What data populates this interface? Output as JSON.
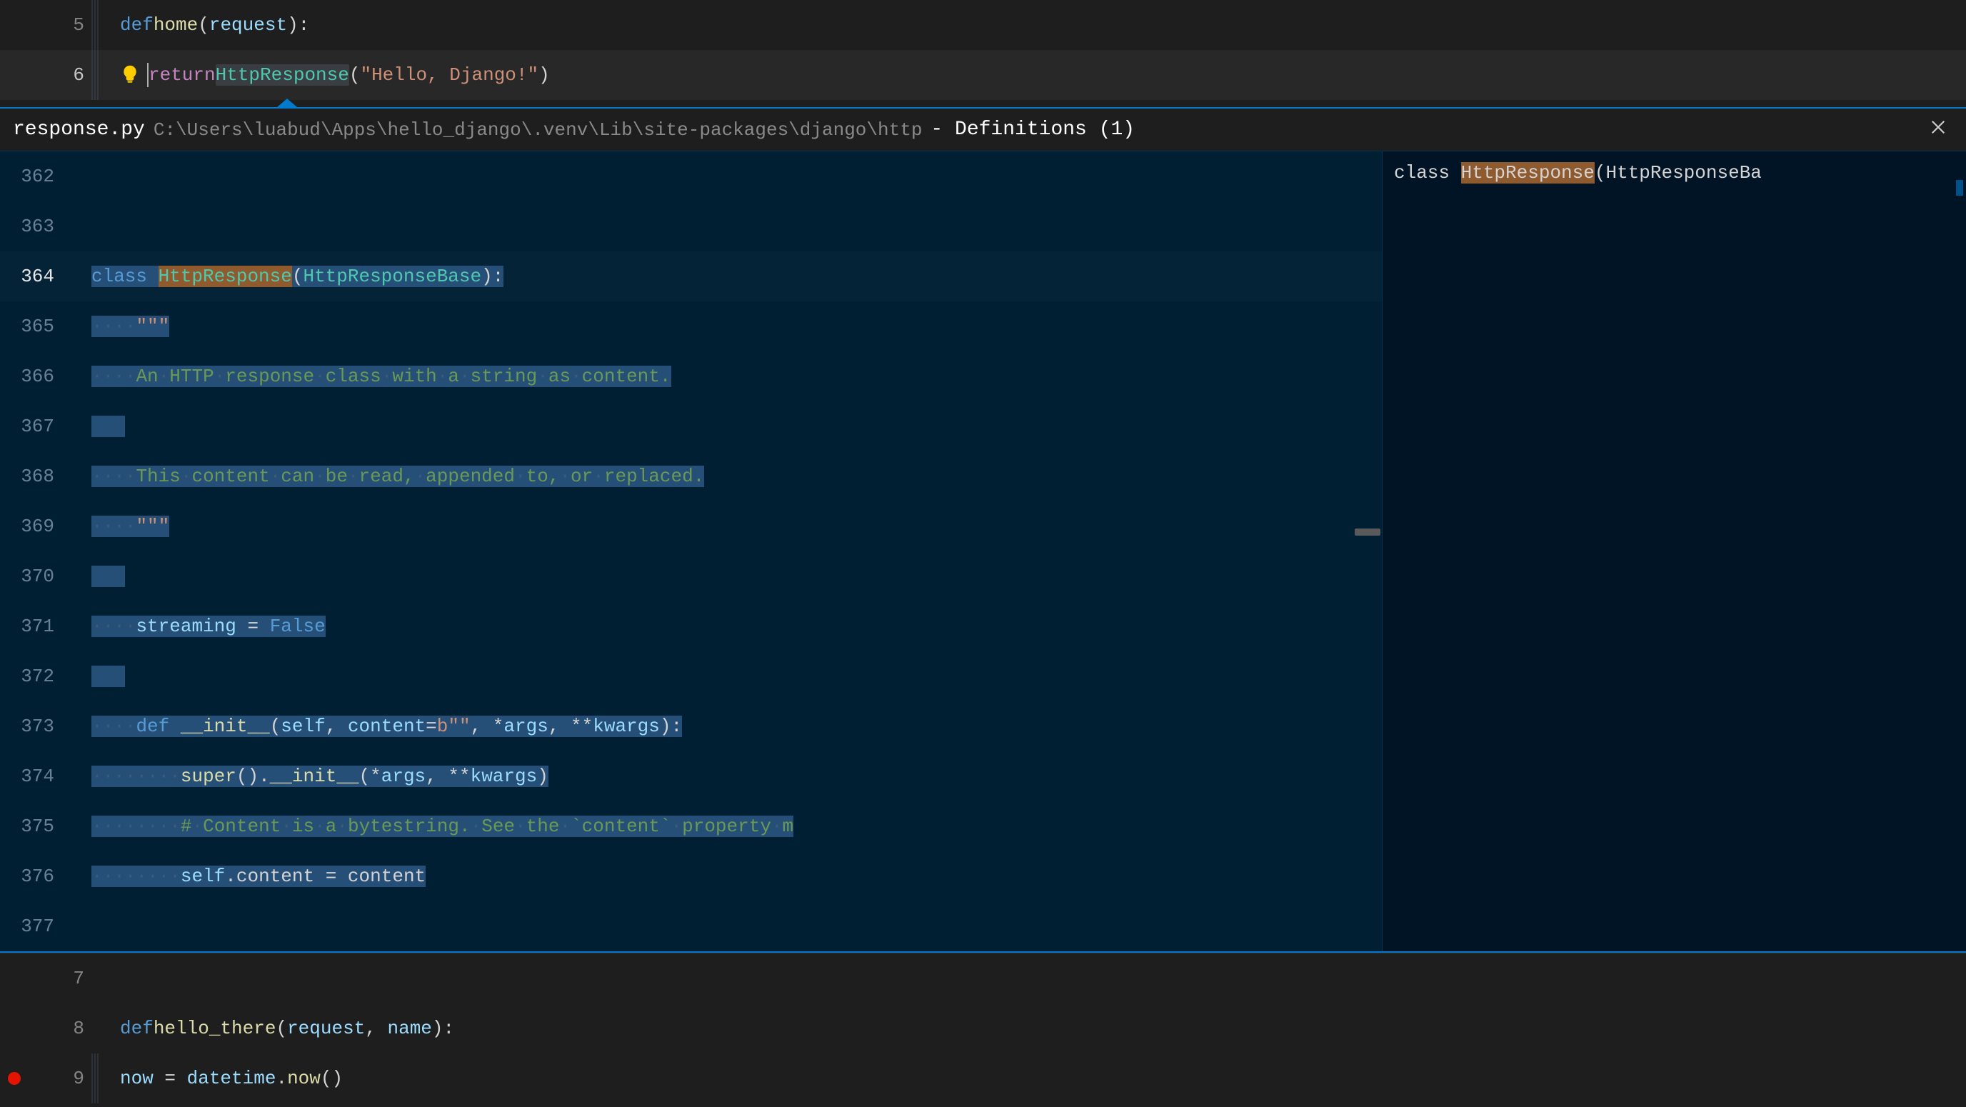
{
  "editor": {
    "top_lines": [
      {
        "num": "5",
        "fold": true,
        "code_html": "<span class='kw'>def</span> <span class='fn'>home</span>(<span class='var'>request</span>):"
      },
      {
        "num": "6",
        "fold": true,
        "active": true,
        "lightbulb": true,
        "code_html": "    <span class='kw2'>return</span> <span class='cls hl-ref'>HttpResponse</span>(<span class='str'>\"Hello, Django!\"</span>)"
      }
    ],
    "bottom_lines": [
      {
        "num": "7",
        "code_html": ""
      },
      {
        "num": "8",
        "code_html": "<span class='kw'>def</span> <span class='fn'>hello_there</span>(<span class='var'>request</span>, <span class='var'>name</span>):"
      },
      {
        "num": "9",
        "fold": true,
        "breakpoint": true,
        "code_html": "    <span class='var'>now</span> = <span class='var'>datetime</span>.<span class='fn'>now</span>()"
      }
    ]
  },
  "peek": {
    "filename": "response.py",
    "path": "C:\\Users\\luabud\\Apps\\hello_django\\.venv\\Lib\\site-packages\\django\\http",
    "defs_label": "- Definitions (1)",
    "sidebar_item_prefix": "class ",
    "sidebar_item_hl": "HttpResponse",
    "sidebar_item_suffix": "(HttpResponseBa",
    "lines": [
      {
        "num": "362",
        "content": ""
      },
      {
        "num": "363",
        "content": ""
      },
      {
        "num": "364",
        "active": true,
        "segments": [
          {
            "t": "class ",
            "cls": "kw sel"
          },
          {
            "t": "HttpResponse",
            "cls": "cls hl-def"
          },
          {
            "t": "(",
            "cls": "sel"
          },
          {
            "t": "HttpResponseBase",
            "cls": "cls sel"
          },
          {
            "t": "):",
            "cls": "sel"
          }
        ]
      },
      {
        "num": "365",
        "indent": 1,
        "segments": [
          {
            "t": "····",
            "cls": "whitespace-dot sel"
          },
          {
            "t": "\"\"\"",
            "cls": "str sel"
          }
        ]
      },
      {
        "num": "366",
        "indent": 1,
        "segments": [
          {
            "t": "····",
            "cls": "whitespace-dot sel"
          },
          {
            "t": "An·HTTP·response·class·with·a·string·as·content.",
            "cls": "comment sel"
          }
        ]
      },
      {
        "num": "367",
        "indent": 1,
        "segments": [
          {
            "t": "   ",
            "cls": "sel"
          }
        ]
      },
      {
        "num": "368",
        "indent": 1,
        "segments": [
          {
            "t": "····",
            "cls": "whitespace-dot sel"
          },
          {
            "t": "This·content·can·be·read,·appended·to,·or·replaced.",
            "cls": "comment sel"
          }
        ]
      },
      {
        "num": "369",
        "indent": 1,
        "segments": [
          {
            "t": "····",
            "cls": "whitespace-dot sel"
          },
          {
            "t": "\"\"\"",
            "cls": "str sel"
          }
        ]
      },
      {
        "num": "370",
        "indent": 1,
        "segments": [
          {
            "t": "   ",
            "cls": "sel"
          }
        ]
      },
      {
        "num": "371",
        "indent": 1,
        "segments": [
          {
            "t": "····",
            "cls": "whitespace-dot sel"
          },
          {
            "t": "streaming",
            "cls": "var sel"
          },
          {
            "t": " = ",
            "cls": "op sel"
          },
          {
            "t": "False",
            "cls": "const sel"
          }
        ]
      },
      {
        "num": "372",
        "indent": 1,
        "segments": [
          {
            "t": "   ",
            "cls": "sel"
          }
        ]
      },
      {
        "num": "373",
        "indent": 1,
        "segments": [
          {
            "t": "····",
            "cls": "whitespace-dot sel"
          },
          {
            "t": "def ",
            "cls": "kw sel"
          },
          {
            "t": "__init__",
            "cls": "fn sel"
          },
          {
            "t": "(",
            "cls": "sel"
          },
          {
            "t": "self",
            "cls": "var sel"
          },
          {
            "t": ", ",
            "cls": "sel"
          },
          {
            "t": "content",
            "cls": "var sel"
          },
          {
            "t": "=",
            "cls": "sel"
          },
          {
            "t": "b\"\"",
            "cls": "str sel"
          },
          {
            "t": ", *",
            "cls": "sel"
          },
          {
            "t": "args",
            "cls": "var sel"
          },
          {
            "t": ", **",
            "cls": "sel"
          },
          {
            "t": "kwargs",
            "cls": "var sel"
          },
          {
            "t": "):",
            "cls": "sel"
          }
        ]
      },
      {
        "num": "374",
        "indent": 2,
        "segments": [
          {
            "t": "········",
            "cls": "whitespace-dot sel"
          },
          {
            "t": "super",
            "cls": "fn sel"
          },
          {
            "t": "().",
            "cls": "sel"
          },
          {
            "t": "__init__",
            "cls": "fn sel"
          },
          {
            "t": "(*",
            "cls": "sel"
          },
          {
            "t": "args",
            "cls": "var sel"
          },
          {
            "t": ", **",
            "cls": "sel"
          },
          {
            "t": "kwargs",
            "cls": "var sel"
          },
          {
            "t": ")",
            "cls": "sel"
          }
        ]
      },
      {
        "num": "375",
        "indent": 2,
        "segments": [
          {
            "t": "········",
            "cls": "whitespace-dot sel"
          },
          {
            "t": "#·Content·is·a·bytestring.·See·the·`content`·property·m",
            "cls": "comment sel"
          }
        ]
      },
      {
        "num": "376",
        "indent": 2,
        "segments": [
          {
            "t": "········",
            "cls": "whitespace-dot sel"
          },
          {
            "t": "self",
            "cls": "var sel"
          },
          {
            "t": ".content = content",
            "cls": "op sel"
          }
        ]
      },
      {
        "num": "377",
        "content": ""
      }
    ]
  }
}
